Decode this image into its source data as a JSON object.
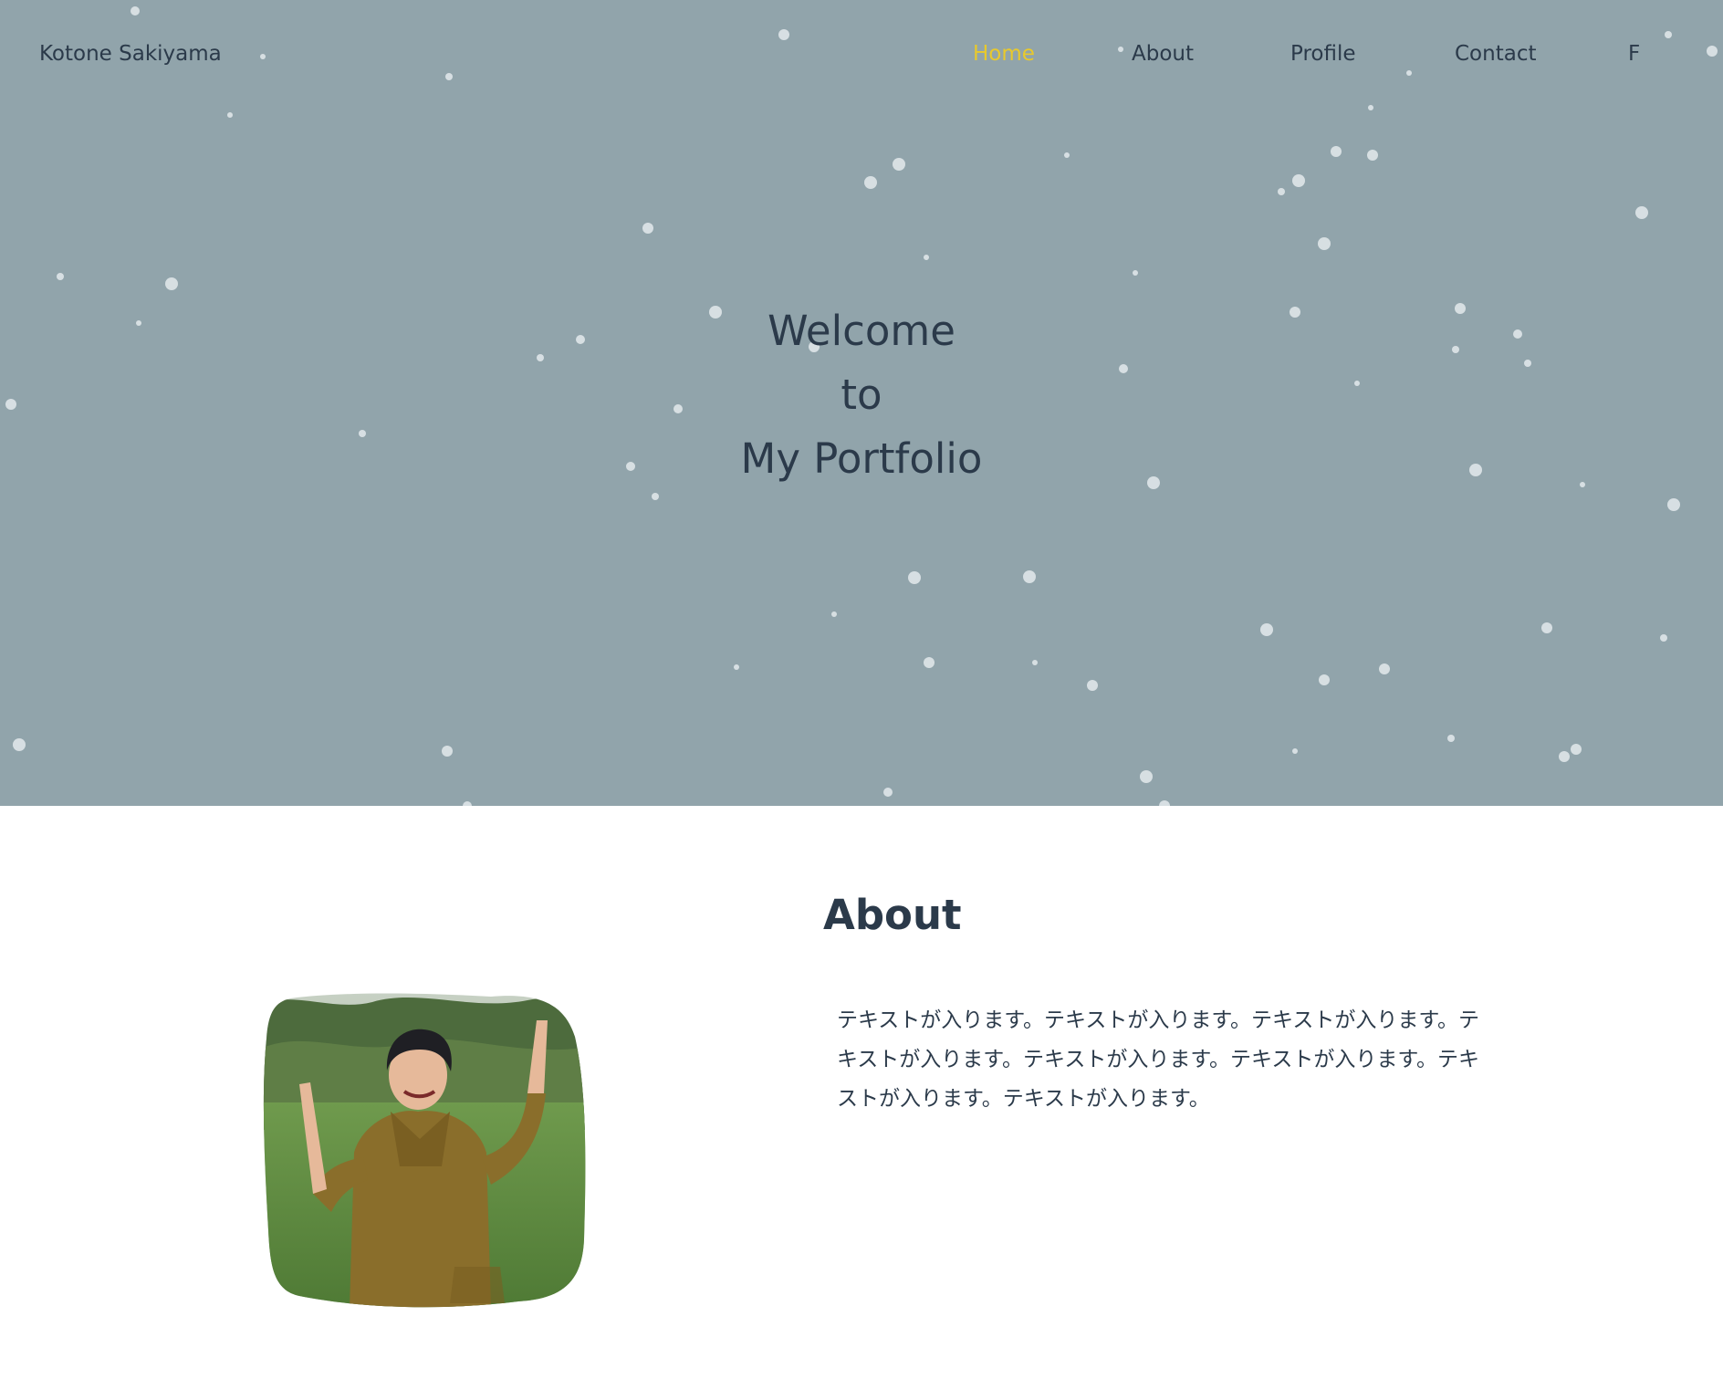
{
  "header": {
    "logo": "Kotone Sakiyama",
    "nav": [
      {
        "label": "Home",
        "active": true
      },
      {
        "label": "About",
        "active": false
      },
      {
        "label": "Profile",
        "active": false
      },
      {
        "label": "Contact",
        "active": false
      },
      {
        "label": "F",
        "active": false
      }
    ]
  },
  "hero": {
    "lines": [
      "Welcome",
      "to",
      "My Portfolio"
    ],
    "background": "#91a4ab"
  },
  "about": {
    "heading": "About",
    "text": "テキストが入ります。テキストが入ります。テキストが入ります。テキストが入ります。テキストが入ります。テキストが入ります。テキストが入ります。テキストが入ります。"
  },
  "colors": {
    "accent": "#e8c92c",
    "text": "#2b3a4a",
    "hero_bg": "#91a4ab"
  }
}
